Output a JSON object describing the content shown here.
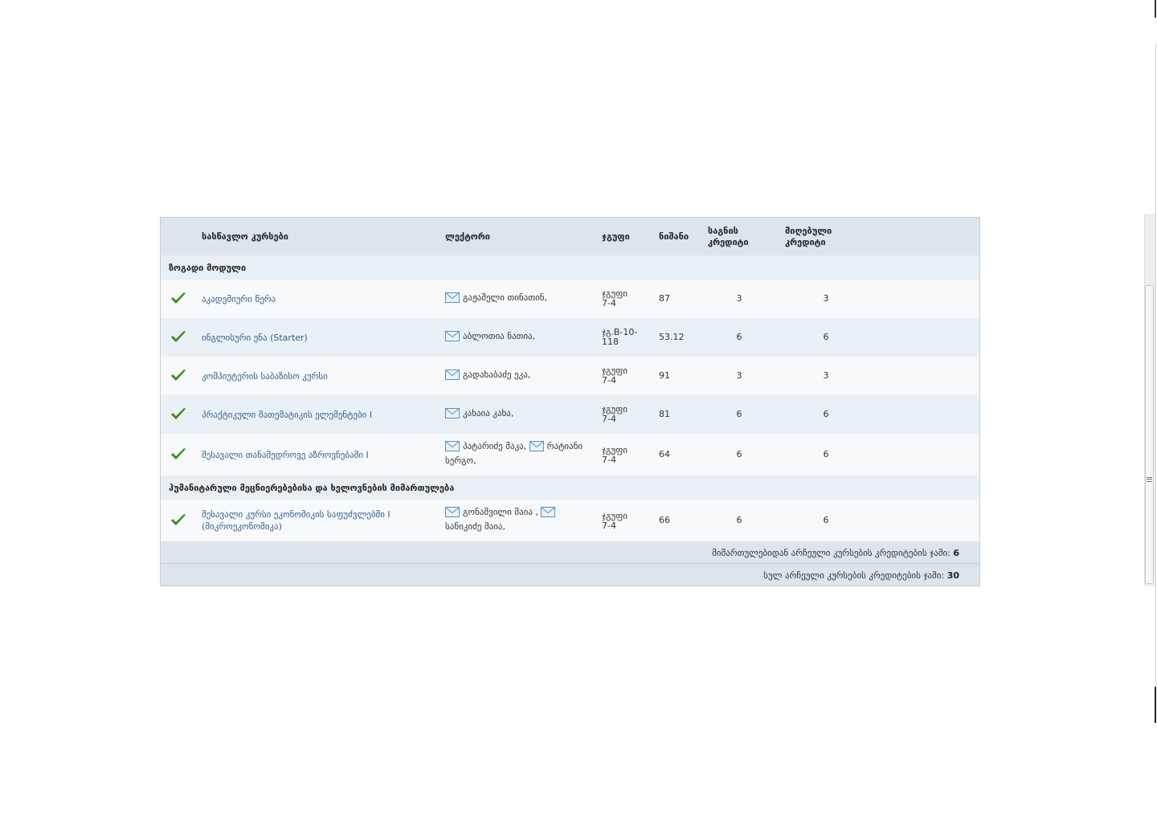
{
  "table": {
    "headers": {
      "course": "სასწავლო კურსები",
      "lecturer": "ლექტორი",
      "group": "ჯგუფი",
      "grade": "ნიშანი",
      "credit_l1": "საგნის",
      "credit_l2": "კრედიტი",
      "earned_l1": "მიღებული",
      "earned_l2": "კრედიტი"
    },
    "groups": [
      {
        "title": "ზოგადი მოდული",
        "rows": [
          {
            "course": "აკადემიური წერა",
            "lecturers": [
              "გაჟაშელი თინათინ,"
            ],
            "group_l1": "ჯგუფი",
            "group_l2": "7-4",
            "grade": "87",
            "credit": "3",
            "earned": "3"
          },
          {
            "course": "ინგლისური ენა (Starter)",
            "lecturers": [
              "აბლოთია ნათია,"
            ],
            "group_l1": "ჯგ.B-10-",
            "group_l2": "118",
            "grade": "53.12",
            "credit": "6",
            "earned": "6"
          },
          {
            "course": "კომპიუტერის საბაზისო კურსი",
            "lecturers": [
              "გადახაბაძე ეკა,"
            ],
            "group_l1": "ჯგუფი",
            "group_l2": "7-4",
            "grade": "91",
            "credit": "3",
            "earned": "3"
          },
          {
            "course": "პრაქტიკული მათემატიკის ელემენტები I",
            "lecturers": [
              "კახაია კახა,"
            ],
            "group_l1": "ჯგუფი",
            "group_l2": "7-4",
            "grade": "81",
            "credit": "6",
            "earned": "6"
          },
          {
            "course": "შესავალი თანამედროვე აზროვნებაში I",
            "lecturers": [
              "პატარიძე მაკა,",
              "რატიანი სერგო,"
            ],
            "group_l1": "ჯგუფი",
            "group_l2": "7-4",
            "grade": "64",
            "credit": "6",
            "earned": "6"
          }
        ]
      },
      {
        "title": "ჰუმანიტარული მეცნიერებებისა და ხელოვნების მიმართულება",
        "rows": [
          {
            "course_l1": "შესავალი კურსი ეკონომიკის საფუძვლებში I",
            "course_l2": "(მიკროეკონომიკა)",
            "lecturers": [
              "გონაშვილი მაია ,",
              "სანიკიძე მაია,"
            ],
            "group_l1": "ჯგუფი",
            "group_l2": "7-4",
            "grade": "66",
            "credit": "6",
            "earned": "6"
          }
        ]
      }
    ],
    "summary": {
      "direction_label": "მიმართულებიდან არჩეული კურსების კრედიტების ჯამი:",
      "direction_value": "6",
      "total_label": "სულ არჩეული კურსების კრედიტების ჯამი:",
      "total_value": "30"
    }
  },
  "icons": {
    "check": "check-icon",
    "mail": "mail-icon"
  },
  "colors": {
    "header_bg": "#dce5ec",
    "link": "#2f5f8f",
    "check": "#3a8a1a"
  }
}
